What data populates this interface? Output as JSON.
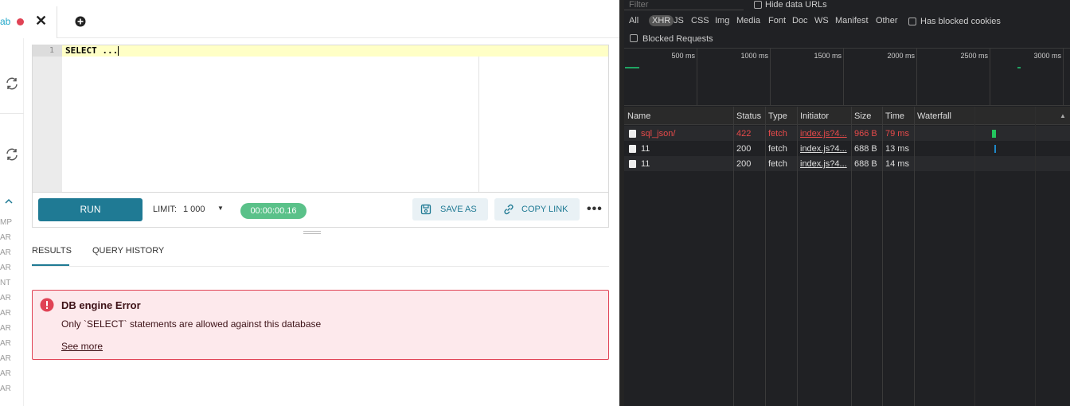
{
  "query_tab": {
    "name": "ab"
  },
  "editor": {
    "line_number": "1",
    "code": "SELECT ..."
  },
  "sidebar": {
    "type_labels": [
      "MP",
      "AR",
      "AR",
      "AR",
      "NT",
      "AR",
      "AR",
      "AR",
      "AR",
      "AR",
      "AR",
      "AR"
    ]
  },
  "toolbar": {
    "run_label": "RUN",
    "limit_label": "LIMIT:",
    "limit_value": "1 000",
    "timer": "00:00:00.16",
    "save_as_label": "SAVE AS",
    "copy_link_label": "COPY LINK",
    "more_label": "•••"
  },
  "results": {
    "tabs": [
      "RESULTS",
      "QUERY HISTORY"
    ],
    "active_tab": "RESULTS"
  },
  "error": {
    "title": "DB engine Error",
    "message": "Only `SELECT` statements are allowed against this database",
    "link": "See more"
  },
  "devtools": {
    "filter_placeholder": "Filter",
    "hide_data_urls": "Hide data URLs",
    "type_filters": [
      "All",
      "XHR",
      "JS",
      "CSS",
      "Img",
      "Media",
      "Font",
      "Doc",
      "WS",
      "Manifest",
      "Other"
    ],
    "active_filter": "XHR",
    "has_blocked_cookies": "Has blocked cookies",
    "blocked_requests": "Blocked Requests",
    "overview_ticks": [
      "500 ms",
      "1000 ms",
      "1500 ms",
      "2000 ms",
      "2500 ms",
      "3000 ms"
    ],
    "columns": [
      "Name",
      "Status",
      "Type",
      "Initiator",
      "Size",
      "Time",
      "Waterfall"
    ],
    "requests": [
      {
        "name": "sql_json/",
        "status": "422",
        "type": "fetch",
        "initiator": "index.js?4...",
        "size": "966 B",
        "time": "79 ms",
        "error": true
      },
      {
        "name": "11",
        "status": "200",
        "type": "fetch",
        "initiator": "index.js?4...",
        "size": "688 B",
        "time": "13 ms",
        "error": false
      },
      {
        "name": "11",
        "status": "200",
        "type": "fetch",
        "initiator": "index.js?4...",
        "size": "688 B",
        "time": "14 ms",
        "error": false
      }
    ],
    "colors": {
      "overview_green": "#1fa463",
      "waterfall_green": "#23c55e",
      "waterfall_blue": "#1e88c8"
    }
  }
}
